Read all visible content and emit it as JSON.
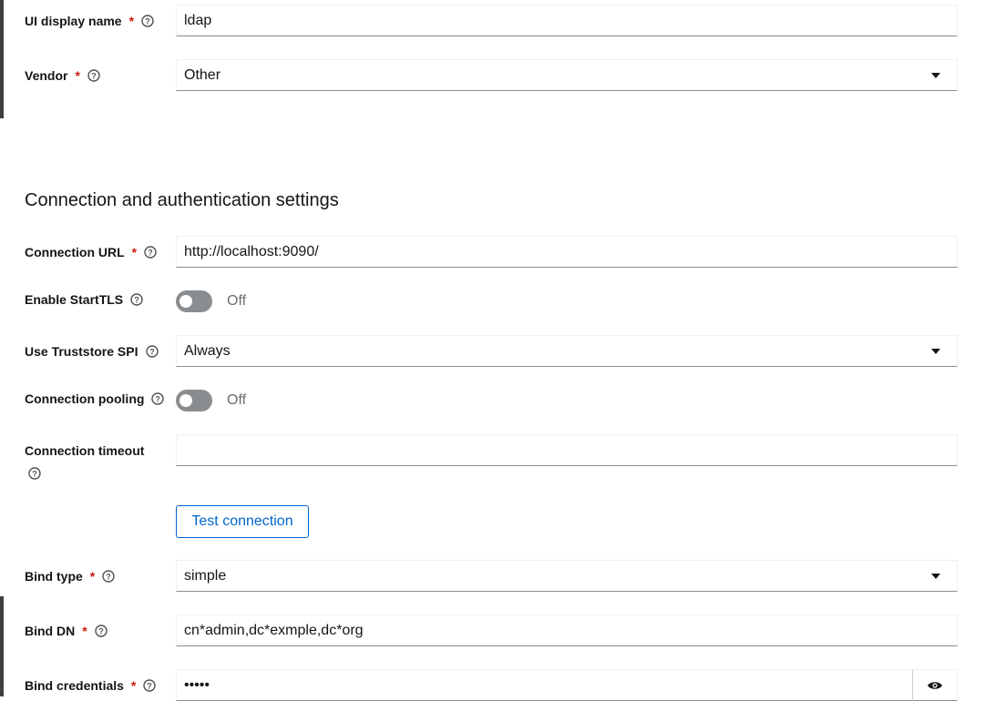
{
  "form": {
    "ui_display_name": {
      "label": "UI display name",
      "required": "*",
      "value": "ldap"
    },
    "vendor": {
      "label": "Vendor",
      "required": "*",
      "value": "Other"
    },
    "section_title": "Connection and authentication settings",
    "connection_url": {
      "label": "Connection URL",
      "required": "*",
      "value": "http://localhost:9090/"
    },
    "enable_starttls": {
      "label": "Enable StartTLS",
      "state": "Off"
    },
    "use_truststore_spi": {
      "label": "Use Truststore SPI",
      "value": "Always"
    },
    "connection_pooling": {
      "label": "Connection pooling",
      "state": "Off"
    },
    "connection_timeout": {
      "label": "Connection timeout",
      "value": ""
    },
    "test_connection_label": "Test connection",
    "bind_type": {
      "label": "Bind type",
      "required": "*",
      "value": "simple"
    },
    "bind_dn": {
      "label": "Bind DN",
      "required": "*",
      "value": "cn*admin,dc*exmple,dc*org"
    },
    "bind_credentials": {
      "label": "Bind credentials",
      "required": "*",
      "value": "•••••"
    }
  },
  "icons": {
    "help": "help-circle-icon",
    "select_caret": "caret-down-icon",
    "reveal": "eye-icon"
  },
  "colors": {
    "required": "#c9190b",
    "link_blue": "#0066cc",
    "toggle_off": "#8a8d90",
    "border": "#8a8d90"
  }
}
